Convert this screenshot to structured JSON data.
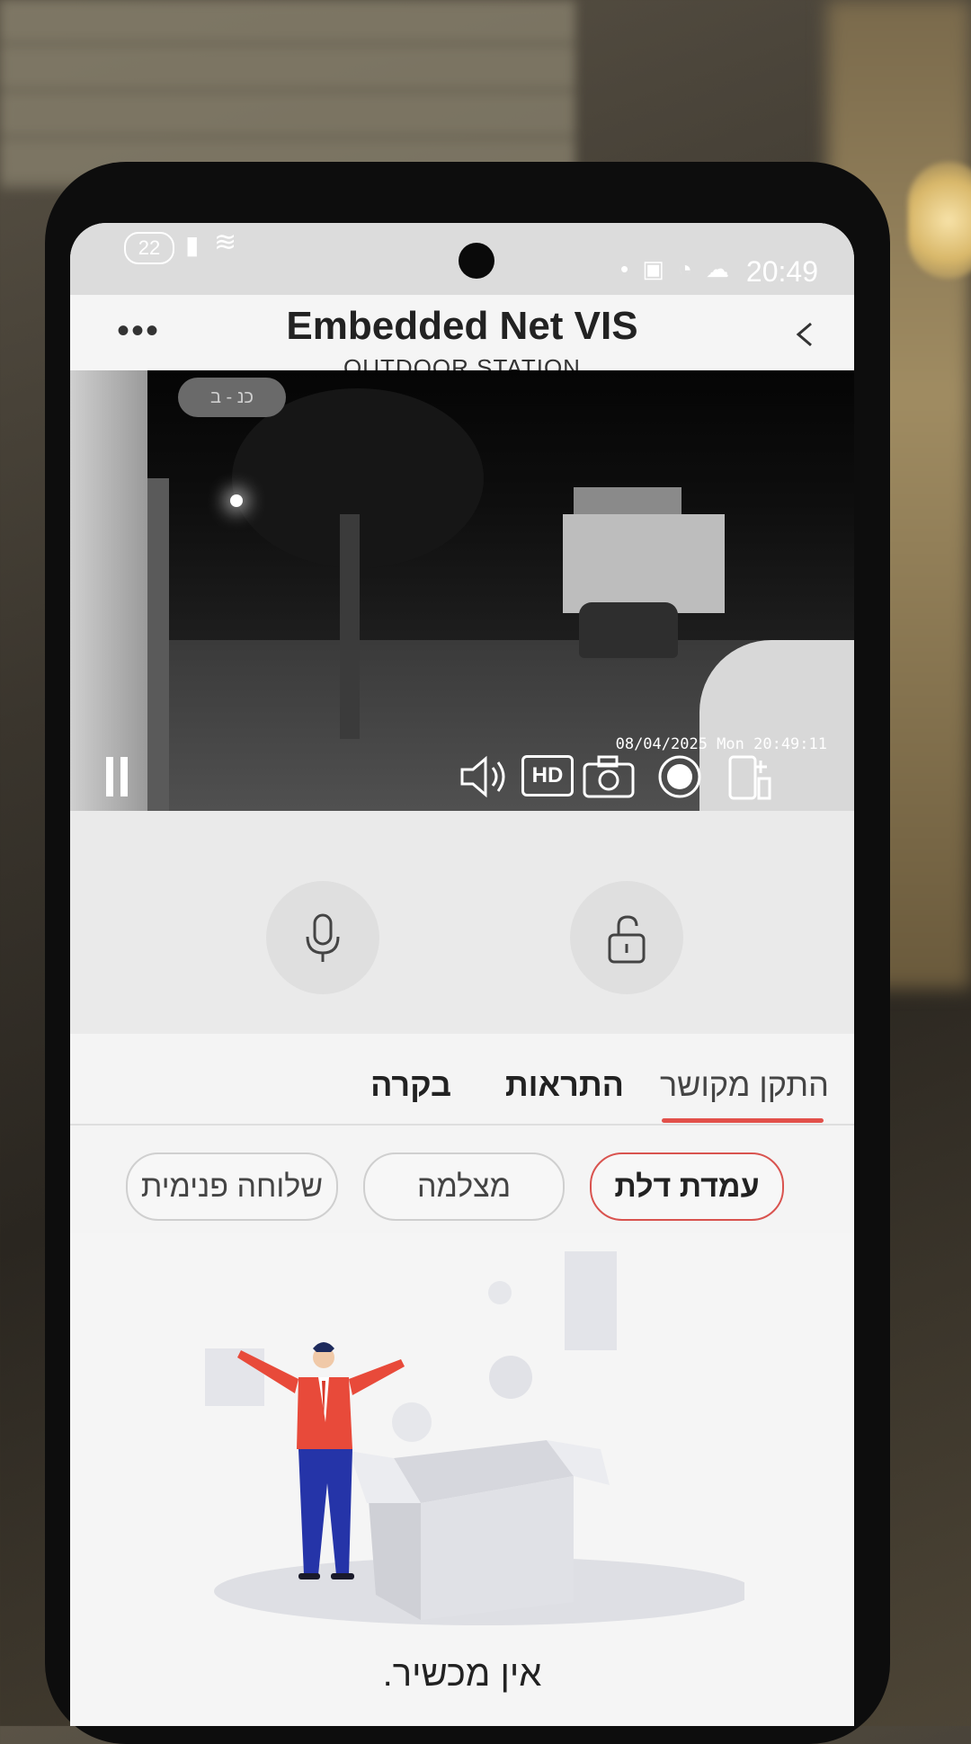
{
  "status_bar": {
    "notification_count": "22",
    "time": "20:49"
  },
  "header": {
    "title": "Embedded Net VIS",
    "subtitle": "OUTDOOR STATION",
    "more_icon": "more-dots-icon",
    "back_icon": "chevron-left-icon"
  },
  "video": {
    "overlay_badge": "כנ - ב",
    "timestamp": "08/04/2025 Mon 20:49:11",
    "hd_label": "HD",
    "controls": [
      "pause-icon",
      "speaker-icon",
      "hd-icon",
      "snapshot-camera-icon",
      "record-icon",
      "phone-add-icon"
    ]
  },
  "actions": {
    "mic_icon": "microphone-icon",
    "unlock_icon": "unlock-padlock-icon"
  },
  "tabs": [
    {
      "label": "התקן מקושר",
      "active": true
    },
    {
      "label": "התראות",
      "active": false
    },
    {
      "label": "בקרה",
      "active": false
    }
  ],
  "chips": [
    {
      "label": "עמדת דלת",
      "active": true
    },
    {
      "label": "מצלמה",
      "active": false
    },
    {
      "label": "שלוחה פנימית",
      "active": false
    }
  ],
  "empty_state": {
    "message": "אין מכשיר.",
    "illustration": "person-with-empty-box-illustration"
  },
  "colors": {
    "accent": "#e2504a",
    "background": "#f5f5f5"
  }
}
